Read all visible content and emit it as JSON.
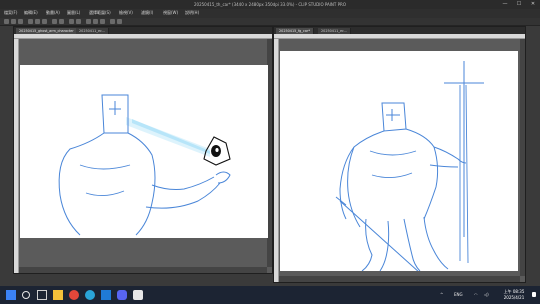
{
  "window": {
    "title": "20250415_th_car* (3440 x 2480px 350dpi 33.0%) - CLIP STUDIO PAINT PRO",
    "min": "—",
    "max": "☐",
    "close": "✕"
  },
  "menu": [
    "檔案(F)",
    "編輯(E)",
    "動畫(A)",
    "圖層(L)",
    "選擇範圍(S)",
    "檢視(V)",
    "濾鏡(I)",
    "視窗(W)",
    "說明(H)"
  ],
  "left_panel": {
    "tabs": [
      "20250415_ghost_arm_character",
      "20250411_ec..."
    ]
  },
  "right_panel": {
    "tabs": [
      "20250415_fg_car*",
      "20250411_ec..."
    ]
  },
  "taskbar": {
    "icons": [
      "windows-icon",
      "search-icon",
      "task-view-icon",
      "file-explorer-icon",
      "chrome-icon",
      "edge-icon",
      "vscode-icon",
      "discord-icon",
      "clip-studio-icon"
    ],
    "tray_language": "ENG",
    "time": "上午 08:35",
    "date": "2025/4/21"
  },
  "colors": {
    "sketch_blue": "#4a86d8",
    "taskbar": "#1c2433"
  }
}
